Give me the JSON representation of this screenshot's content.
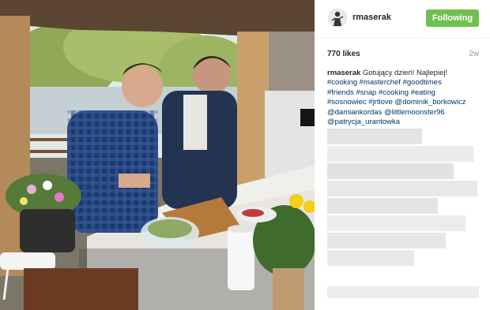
{
  "post": {
    "username": "rmaserak",
    "follow_label": "Following",
    "likes": "770 likes",
    "time": "2w",
    "caption_text": "Gotujący dzień! Najlepiej!",
    "hashtags_line1": [
      "#cooking",
      "#masterchef",
      "#goodtimes"
    ],
    "hashtags_line2": [
      "#friends",
      "#snap",
      "#cooking",
      "#eating"
    ],
    "line3": [
      "#sosnowiec",
      "#jrtlove",
      "@dominik_borkowicz"
    ],
    "line4": [
      "@damiankordas",
      "@littlemoonster96"
    ],
    "line5": [
      "@patrycja_urantowka"
    ]
  },
  "colors": {
    "follow_bg": "#70c050",
    "link": "#003569",
    "text": "#262626",
    "muted": "#999999"
  },
  "icons": {
    "avatar": "user-avatar-icon"
  }
}
